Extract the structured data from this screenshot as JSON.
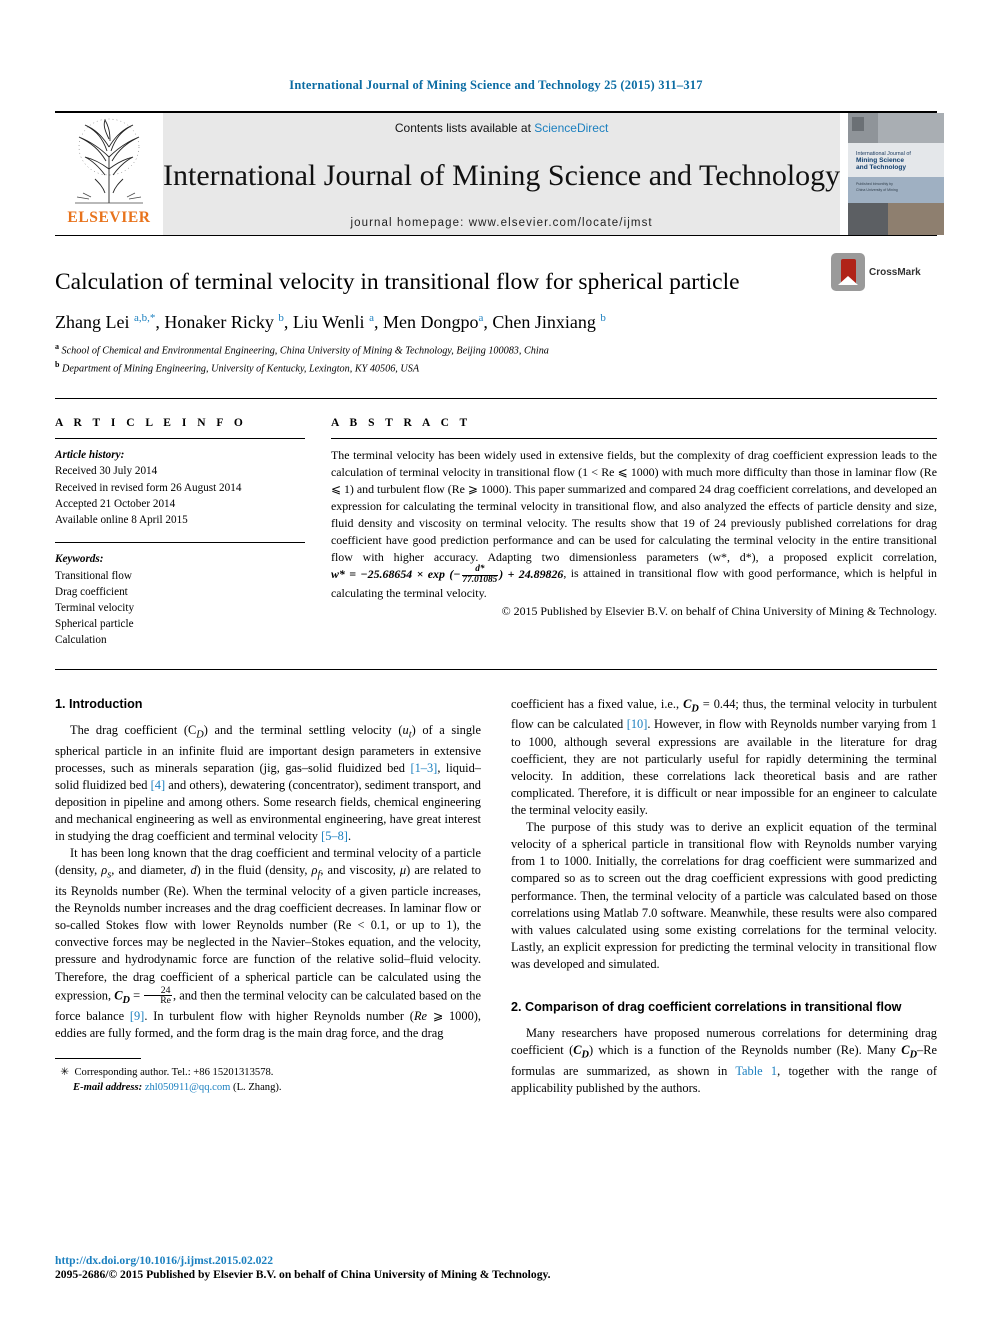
{
  "running_head": "International Journal of Mining Science and Technology 25 (2015) 311–317",
  "masthead": {
    "contents_prefix": "Contents lists available at ",
    "sciencedirect": "ScienceDirect",
    "journal_name": "International Journal of Mining Science and Technology",
    "homepage": "journal homepage: www.elsevier.com/locate/ijmst",
    "publisher": "ELSEVIER",
    "cover_title": "International Journal of\nMining Science\nand Technology"
  },
  "article": {
    "title": "Calculation of terminal velocity in transitional flow for spherical particle",
    "crossmark_label": "CrossMark",
    "authors_html": "Zhang Lei <sup>a,b,*</sup>, Honaker Ricky <sup>b</sup>, Liu Wenli <sup>a</sup>, Men Dongpo<sup>a</sup>, Chen Jinxiang <sup>b</sup>",
    "affiliations": [
      "School of Chemical and Environmental Engineering, China University of Mining & Technology, Beijing 100083, China",
      "Department of Mining Engineering, University of Kentucky, Lexington, KY 40506, USA"
    ]
  },
  "article_info": {
    "heading": "A R T I C L E  I N F O",
    "history_label": "Article history:",
    "history": [
      "Received 30 July 2014",
      "Received in revised form 26 August 2014",
      "Accepted 21 October 2014",
      "Available online 8 April 2015"
    ],
    "keywords_label": "Keywords:",
    "keywords": [
      "Transitional flow",
      "Drag coefficient",
      "Terminal velocity",
      "Spherical particle",
      "Calculation"
    ]
  },
  "abstract": {
    "heading": "A B S T R A C T",
    "p1_part1": "The terminal velocity has been widely used in extensive fields, but the complexity of drag coefficient expression leads to the calculation of terminal velocity in transitional flow (1 < Re ⩽ 1000) with much more difficulty than those in laminar flow (Re ⩽ 1) and turbulent flow (Re ⩾ 1000). This paper summarized and compared 24 drag coefficient correlations, and developed an expression for calculating the terminal velocity in transitional flow, and also analyzed the effects of particle density and size, fluid density and viscosity on terminal velocity. The results show that 19 of 24 previously published correlations for drag coefficient have good prediction performance and can be used for calculating the terminal velocity in the entire transitional flow with higher accuracy. Adapting two dimensionless parameters (w*, d*), a proposed explicit correlation, ",
    "equation": "w* = −25.68654 × exp (−",
    "equation_num": "d*",
    "equation_den": "77.01085",
    "equation_tail": ") + 24.89826",
    "p1_part2": ", is attained in transitional flow with good performance, which is helpful in calculating the terminal velocity.",
    "copyright": "© 2015 Published by Elsevier B.V. on behalf of China University of Mining & Technology."
  },
  "sections": {
    "intro_heading": "1. Introduction",
    "intro_p1_a": "The drag coefficient (C",
    "intro_p1_b": ") and the terminal settling velocity (",
    "intro_p1_c": ") of a single spherical particle in an infinite fluid are important design parameters in extensive processes, such as minerals separation (jig, gas–solid fluidized bed ",
    "intro_p1_ref1": "[1–3]",
    "intro_p1_d": ", liquid–solid fluidized bed ",
    "intro_p1_ref2": "[4]",
    "intro_p1_e": " and others), dewatering (concentrator), sediment transport, and deposition in pipeline and among others. Some research fields, chemical engineering and mechanical engineering as well as environmental engineering, have great interest in studying the drag coefficient and terminal velocity ",
    "intro_p1_ref3": "[5–8]",
    "intro_p1_f": ".",
    "intro_p2_a": "It has been long known that the drag coefficient and terminal velocity of a particle (density, ",
    "intro_p2_b": ", and diameter, ",
    "intro_p2_c": ") in the fluid (density, ",
    "intro_p2_d": ", and viscosity, ",
    "intro_p2_e": ") are related to its Reynolds number (Re). When the terminal velocity of a given particle increases, the Reynolds number increases and the drag coefficient decreases. In laminar flow or so-called Stokes flow with lower Reynolds number (Re < 0.1, or up to 1), the convective forces may be neglected in the Navier–Stokes equation, and the velocity, pressure and hydrodynamic force are function of the relative solid–fluid velocity. Therefore, the drag coefficient of a spherical particle can be calculated using the expression, ",
    "intro_p2_eq_lhs": "C",
    "intro_p2_eq_sub": "D",
    "intro_p2_eq_eq": " = ",
    "intro_p2_eq_num": "24",
    "intro_p2_eq_den": "Re",
    "intro_p2_f": ", and then the terminal velocity can be calculated based on the force balance ",
    "intro_p2_ref": "[9]",
    "intro_p2_g": ". In turbulent flow with higher Reynolds number (",
    "intro_p2_re": "Re",
    "intro_p2_h": " ⩾ 1000), eddies are fully formed, and the form drag is the main drag force, and the drag",
    "right_p1_a": "coefficient has a fixed value, i.e., ",
    "right_p1_cd": "C",
    "right_p1_sub": "D",
    "right_p1_b": " = 0.44; thus, the terminal velocity in turbulent flow can be calculated ",
    "right_p1_ref": "[10]",
    "right_p1_c": ". However, in flow with Reynolds number varying from 1 to 1000, although several expressions are available in the literature for drag coefficient, they are not particularly useful for rapidly determining the terminal velocity. In addition, these correlations lack theoretical basis and are rather complicated. Therefore, it is difficult or near impossible for an engineer to calculate the terminal velocity easily.",
    "right_p2": "The purpose of this study was to derive an explicit equation of the terminal velocity of a spherical particle in transitional flow with Reynolds number varying from 1 to 1000. Initially, the correlations for drag coefficient were summarized and compared so as to screen out the drag coefficient expressions with good predicting performance. Then, the terminal velocity of a particle was calculated based on those correlations using Matlab 7.0 software. Meanwhile, these results were also compared with values calculated using some existing correlations for the terminal velocity. Lastly, an explicit expression for predicting the terminal velocity in transitional flow was developed and simulated.",
    "sec2_heading": "2. Comparison of drag coefficient correlations in transitional flow",
    "sec2_p1_a": "Many researchers have proposed numerous correlations for determining drag coefficient (",
    "sec2_cd": "C",
    "sec2_sub": "D",
    "sec2_p1_b": ") which is a function of the Reynolds number (Re). Many ",
    "sec2_cdre_a": "C",
    "sec2_cdre_sub": "D",
    "sec2_cdre_b": "–Re",
    "sec2_p1_c": " formulas are summarized, as shown in ",
    "sec2_table_ref": "Table 1",
    "sec2_p1_d": ", together with the range of applicability published by the authors."
  },
  "footnote": {
    "corresponding": "Corresponding author. Tel.: +86 15201313578.",
    "email_label": "E-mail address:",
    "email": "zhl050911@qq.com",
    "email_suffix": " (L. Zhang)."
  },
  "page_footer": {
    "doi": "http://dx.doi.org/10.1016/j.ijmst.2015.02.022",
    "issn_line": "2095-2686/© 2015 Published by Elsevier B.V. on behalf of China University of Mining & Technology."
  },
  "colors": {
    "link": "#1a7fbf",
    "running_head": "#0b6ca3",
    "elsevier_orange": "#e8731c"
  }
}
